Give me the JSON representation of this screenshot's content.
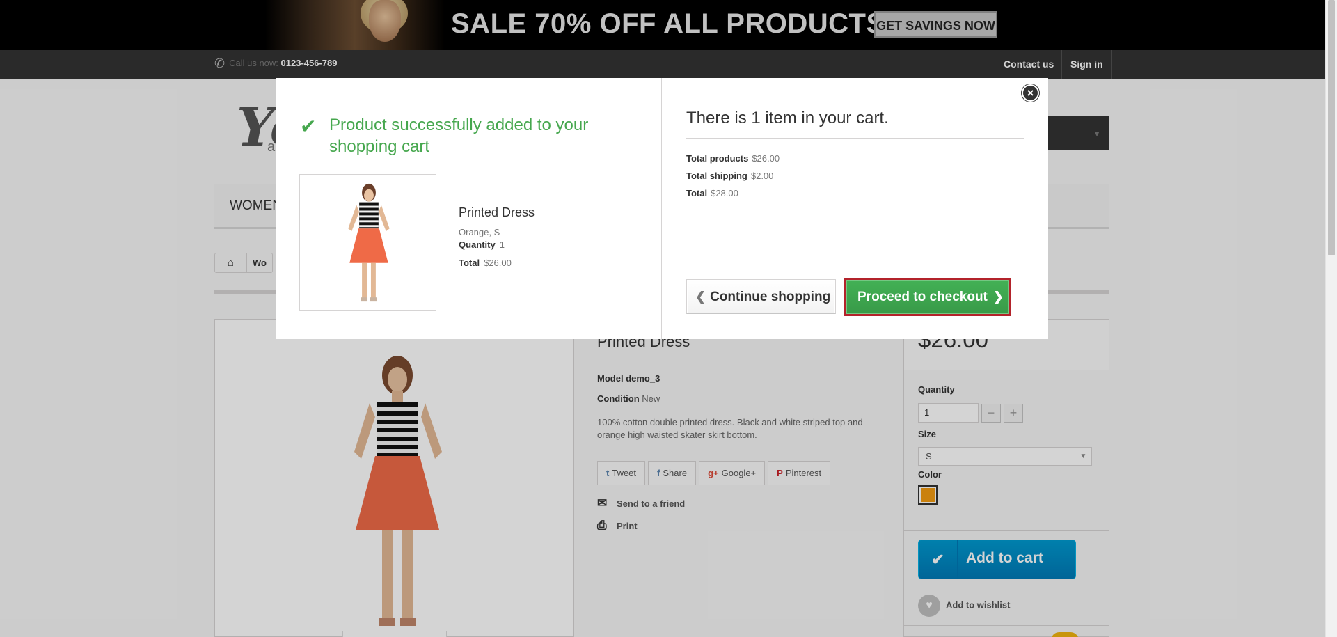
{
  "banner": {
    "headline": "SALE 70% OFF ALL PRODUCTS",
    "cta": "GET SAVINGS NOW"
  },
  "nav": {
    "phone_label": "Call us now:",
    "phone_number": "0123-456-789",
    "contact": "Contact us",
    "signin": "Sign in"
  },
  "header": {
    "logo_text": "Yo",
    "logo_sub": "a",
    "menu_item": "WOMEN",
    "breadcrumb": "Wo"
  },
  "product": {
    "name": "Printed Dress",
    "model_label": "Model",
    "model": "demo_3",
    "condition_label": "Condition",
    "condition": "New",
    "description": "100% cotton double printed dress. Black and white striped top and orange high waisted skater skirt bottom.",
    "shares": {
      "tweet": "Tweet",
      "share": "Share",
      "google": "Google+",
      "pinterest": "Pinterest"
    },
    "send_friend": "Send to a friend",
    "print": "Print",
    "price": "$26.00",
    "quantity_label": "Quantity",
    "quantity": "1",
    "size_label": "Size",
    "size": "S",
    "color_label": "Color",
    "color_hex": "#f39c11",
    "add_to_cart": "Add to cart",
    "wishlist": "Add to wishlist"
  },
  "modal": {
    "success": "Product successfully added to your shopping cart",
    "item_name": "Printed Dress",
    "item_attributes": "Orange, S",
    "quantity_label": "Quantity",
    "quantity": "1",
    "total_label": "Total",
    "total": "$26.00",
    "cart_count": "There is 1 item in your cart.",
    "total_products_label": "Total products",
    "total_products": "$26.00",
    "total_shipping_label": "Total shipping",
    "total_shipping": "$2.00",
    "grand_total_label": "Total",
    "grand_total": "$28.00",
    "continue": "Continue shopping",
    "checkout": "Proceed to checkout"
  },
  "colors": {
    "success_green": "#46a74e",
    "checkout_green": "#43b155",
    "checkout_border": "#b3232b",
    "cart_blue": "#009ad0"
  }
}
